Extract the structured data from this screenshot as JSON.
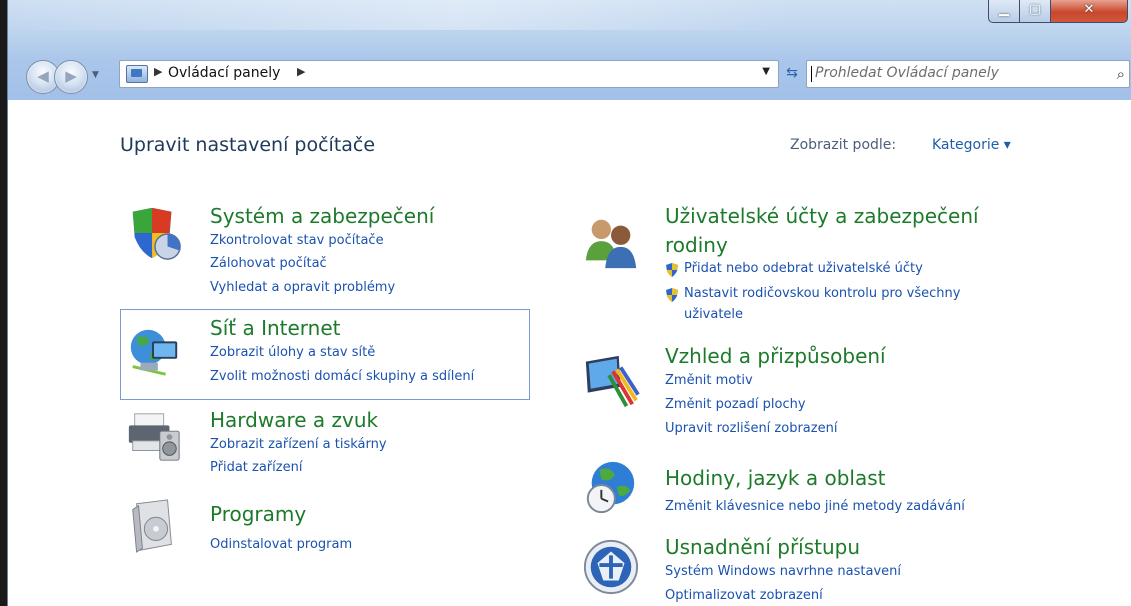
{
  "window": {
    "minimize_icon": "minimize-icon",
    "maximize_icon": "maximize-icon",
    "close_icon": "close-icon"
  },
  "toolbar": {
    "address": "Ovládací panely",
    "search_placeholder": "Prohledat Ovládací panely"
  },
  "main": {
    "title": "Upravit nastavení počítače",
    "view_by_label": "Zobrazit podle:",
    "view_by_value": "Kategorie ▾"
  },
  "categories": [
    {
      "title": "Systém a zabezpečení",
      "icon": "shield-pie-icon",
      "links": [
        "Zkontrolovat stav počítače",
        "Zálohovat počítač",
        "Vyhledat a opravit problémy"
      ]
    },
    {
      "title": "Síť a Internet",
      "icon": "network-globe-icon",
      "links": [
        "Zobrazit úlohy a stav sítě",
        "Zvolit možnosti domácí skupiny a sdílení"
      ]
    },
    {
      "title": "Hardware a zvuk",
      "icon": "printer-speaker-icon",
      "links": [
        "Zobrazit zařízení a tiskárny",
        "Přidat zařízení"
      ]
    },
    {
      "title": "Programy",
      "icon": "programs-box-icon",
      "links": [
        "Odinstalovat program"
      ]
    },
    {
      "title_line1": "Uživatelské účty a zabezpečení",
      "title_line2": "rodiny",
      "icon": "users-icon",
      "links": [
        "Přidat nebo odebrat uživatelské účty",
        "Nastavit rodičovskou kontrolu pro všechny",
        "uživatele"
      ]
    },
    {
      "title": "Vzhled a přizpůsobení",
      "icon": "appearance-monitor-icon",
      "links": [
        "Změnit motiv",
        "Změnit pozadí plochy",
        "Upravit rozlišení zobrazení"
      ]
    },
    {
      "title": "Hodiny, jazyk a oblast",
      "icon": "globe-clock-icon",
      "links": [
        "Změnit klávesnice nebo jiné metody zadávání"
      ]
    },
    {
      "title": "Usnadnění přístupu",
      "icon": "accessibility-icon",
      "links": [
        "Systém Windows navrhne nastavení",
        "Optimalizovat zobrazení"
      ]
    }
  ],
  "colors": {
    "title_green": "#1e7a2b",
    "link_blue": "#1b52b0",
    "heading_navy": "#1e395b"
  }
}
